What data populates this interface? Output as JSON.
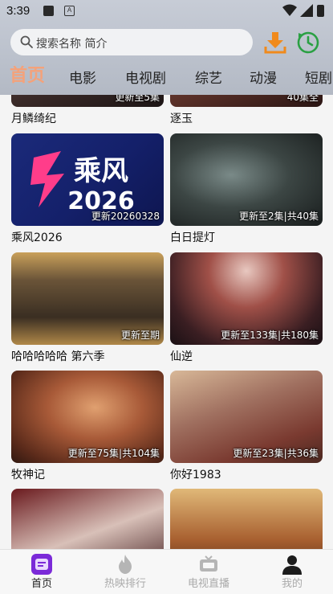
{
  "status": {
    "time": "3:39",
    "a_icon_letter": "A"
  },
  "search": {
    "placeholder": "搜索名称 简介"
  },
  "tabs": [
    {
      "label": "首页",
      "active": true
    },
    {
      "label": "电影"
    },
    {
      "label": "电视剧"
    },
    {
      "label": "综艺"
    },
    {
      "label": "动漫"
    },
    {
      "label": "短剧"
    }
  ],
  "cards": [
    {
      "title": "月鳞绮纪",
      "badge": "更新至5集"
    },
    {
      "title": "逐玉",
      "badge": "40集全"
    },
    {
      "title": "乘风2026",
      "badge": "更新20260328",
      "poster_text": "乘风\n2026"
    },
    {
      "title": "白日提灯",
      "badge": "更新至2集|共40集"
    },
    {
      "title": "哈哈哈哈哈 第六季",
      "badge": "更新至期"
    },
    {
      "title": "仙逆",
      "badge": "更新至133集|共180集"
    },
    {
      "title": "牧神记",
      "badge": "更新至75集|共104集"
    },
    {
      "title": "你好1983",
      "badge": "更新至23集|共36集"
    },
    {
      "title": "",
      "badge": ""
    },
    {
      "title": "",
      "badge": ""
    }
  ],
  "bottom_nav": [
    {
      "label": "首页",
      "active": true,
      "icon": "home-app-icon"
    },
    {
      "label": "热映排行",
      "icon": "fire-icon"
    },
    {
      "label": "电视直播",
      "icon": "tv-icon"
    },
    {
      "label": "我的",
      "icon": "person-icon"
    }
  ],
  "colors": {
    "accent": "#f4a27a",
    "download_orange": "#f08a1c",
    "history_green": "#2aa043"
  }
}
